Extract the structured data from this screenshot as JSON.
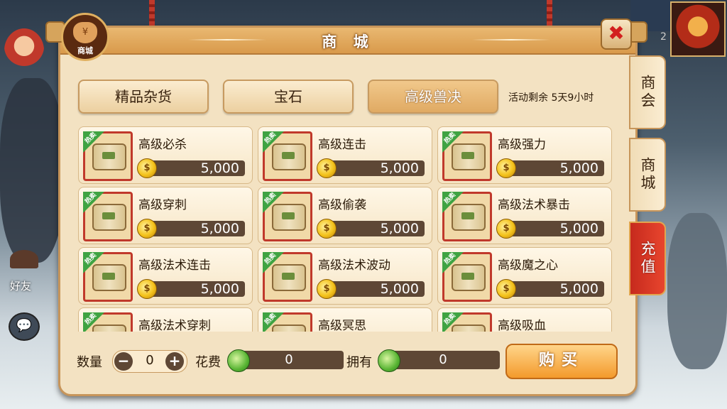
{
  "window": {
    "title": "商 城",
    "emblem_label": "商城",
    "close_label": "✖"
  },
  "hud": {
    "friends_label": "好友",
    "top_number": "2",
    "chat_icon": "💬"
  },
  "categories": [
    {
      "label": "精品杂货",
      "active": false
    },
    {
      "label": "宝石",
      "active": false
    },
    {
      "label": "高级兽决",
      "active": true
    }
  ],
  "event": {
    "remaining": "活动剩余 5天9小时"
  },
  "badge_text": "热卖",
  "coin_symbol": "$",
  "items": [
    {
      "name": "高级必杀",
      "price": "5,000"
    },
    {
      "name": "高级连击",
      "price": "5,000"
    },
    {
      "name": "高级强力",
      "price": "5,000"
    },
    {
      "name": "高级穿刺",
      "price": "5,000"
    },
    {
      "name": "高级偷袭",
      "price": "5,000"
    },
    {
      "name": "高级法术暴击",
      "price": "5,000"
    },
    {
      "name": "高级法术连击",
      "price": "5,000"
    },
    {
      "name": "高级法术波动",
      "price": "5,000"
    },
    {
      "name": "高级魔之心",
      "price": "5,000"
    },
    {
      "name": "高级法术穿刺",
      "price": ""
    },
    {
      "name": "高级冥思",
      "price": ""
    },
    {
      "name": "高级吸血",
      "price": ""
    }
  ],
  "purchase": {
    "quantity_label": "数量",
    "quantity_value": "0",
    "minus_label": "−",
    "plus_label": "+",
    "cost_label": "花费",
    "cost_value": "0",
    "owned_label": "拥有",
    "owned_value": "0",
    "buy_label": "购买"
  },
  "side_tabs": [
    {
      "label": "商会"
    },
    {
      "label": "商城"
    },
    {
      "label": "充值"
    }
  ]
}
